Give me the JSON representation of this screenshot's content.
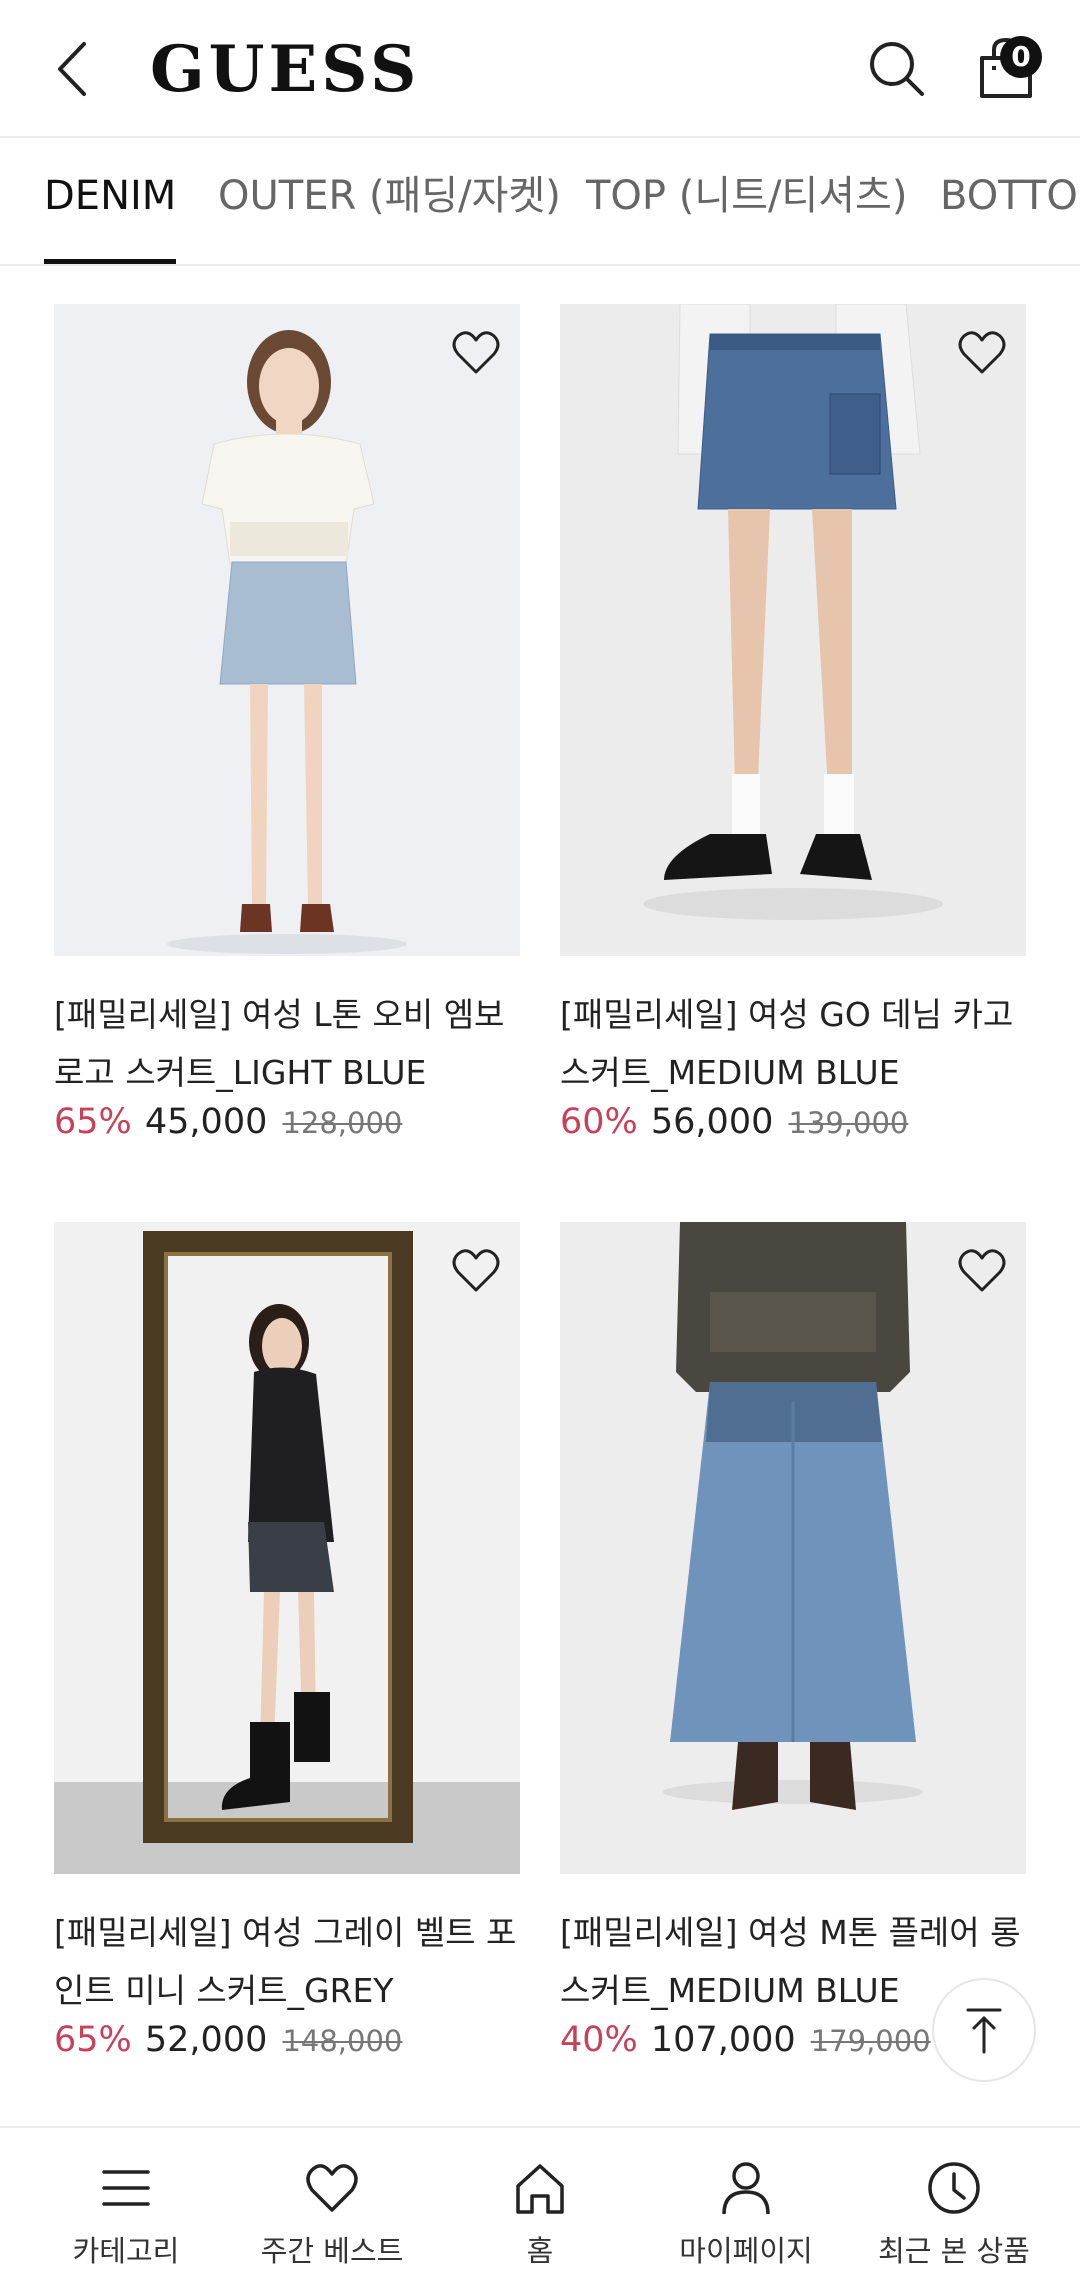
{
  "header": {
    "logo": "GUESS",
    "cart_count": "0",
    "icons": [
      "back-arrow-icon",
      "search-icon",
      "shopping-bag-icon"
    ]
  },
  "tabs": [
    {
      "label": "DENIM",
      "active": true
    },
    {
      "label": "OUTER (패딩/자켓)",
      "active": false
    },
    {
      "label": "TOP (니트/티셔츠)",
      "active": false
    },
    {
      "label": "BOTTOM",
      "active": false
    }
  ],
  "products": [
    {
      "title": "[패밀리세일] 여성 L톤 오비 엠보로고 스커트_LIGHT BLUE",
      "discount": "65%",
      "price": "45,000",
      "original_price": "128,000"
    },
    {
      "title": "[패밀리세일] 여성 GO 데님 카고 스커트_MEDIUM BLUE",
      "discount": "60%",
      "price": "56,000",
      "original_price": "139,000"
    },
    {
      "title": "[패밀리세일] 여성 그레이 벨트 포인트 미니 스커트_GREY",
      "discount": "65%",
      "price": "52,000",
      "original_price": "148,000"
    },
    {
      "title": "[패밀리세일] 여성 M톤 플레어 롱 스커트_MEDIUM BLUE",
      "discount": "40%",
      "price": "107,000",
      "original_price": "179,000"
    }
  ],
  "bottom_nav": [
    {
      "label": "카테고리",
      "icon": "menu-icon"
    },
    {
      "label": "주간 베스트",
      "icon": "heart-icon"
    },
    {
      "label": "홈",
      "icon": "home-icon"
    },
    {
      "label": "마이페이지",
      "icon": "user-icon"
    },
    {
      "label": "최근 본 상품",
      "icon": "clock-icon"
    }
  ],
  "colors": {
    "discount": "#c8415a",
    "text": "#222222",
    "border": "#ececec"
  }
}
